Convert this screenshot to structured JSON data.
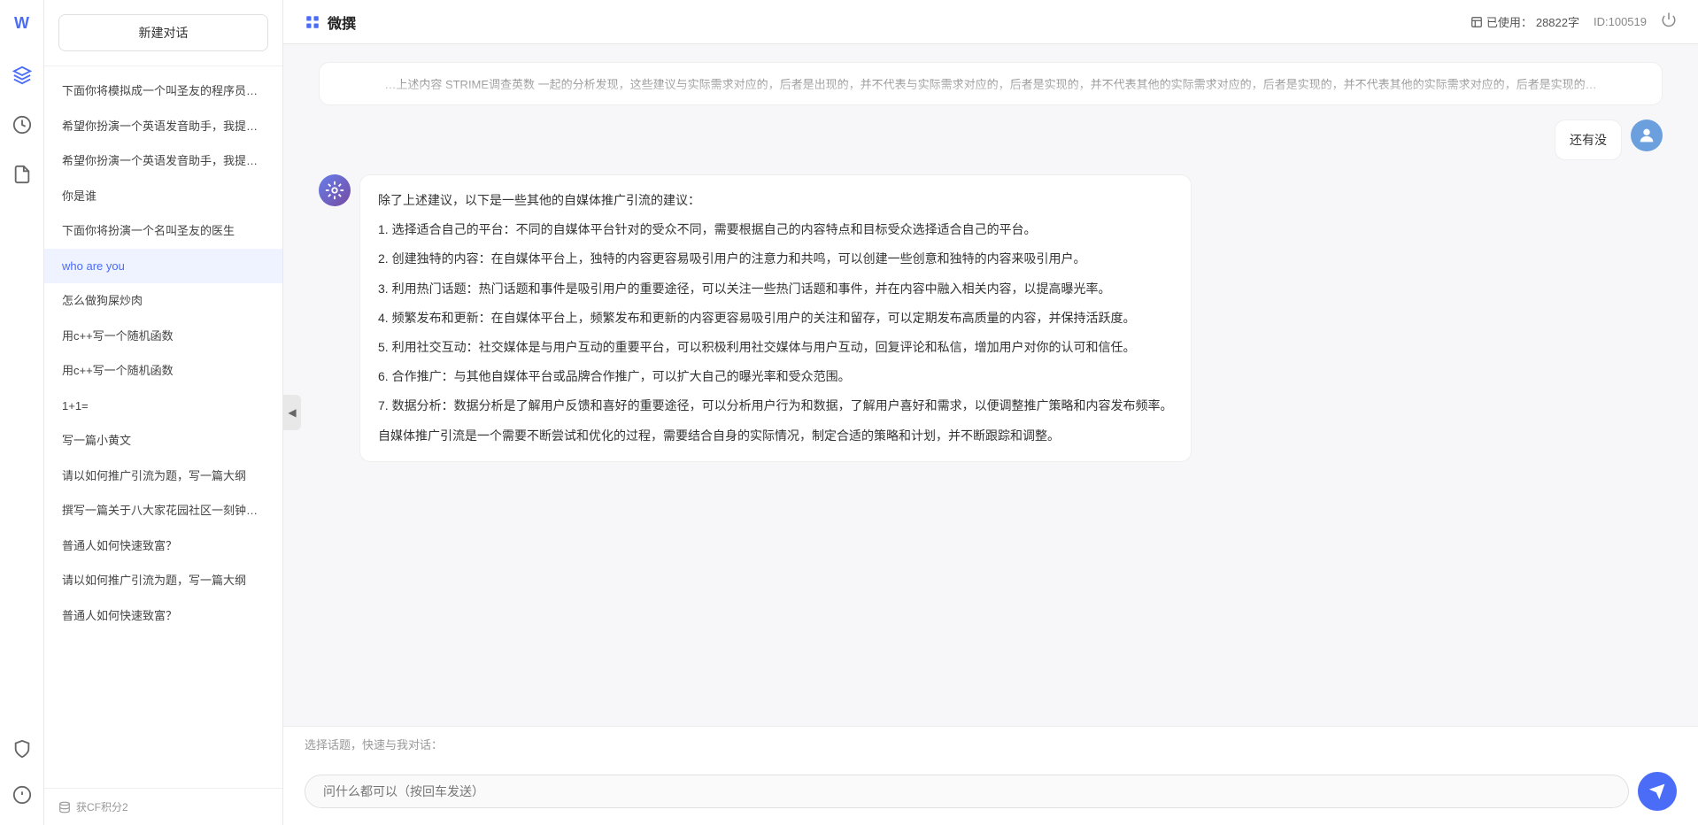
{
  "app": {
    "title": "微撰",
    "usage_label": "已使用：",
    "usage_value": "28822字",
    "id_label": "ID:100519"
  },
  "sidebar": {
    "new_chat": "新建对话",
    "items": [
      {
        "id": 1,
        "label": "下面你将模拟成一个叫圣友的程序员，我说..."
      },
      {
        "id": 2,
        "label": "希望你扮演一个英语发音助手，我提供给你..."
      },
      {
        "id": 3,
        "label": "希望你扮演一个英语发音助手，我提供给你..."
      },
      {
        "id": 4,
        "label": "你是谁"
      },
      {
        "id": 5,
        "label": "下面你将扮演一个名叫圣友的医生"
      },
      {
        "id": 6,
        "label": "who are you",
        "active": true
      },
      {
        "id": 7,
        "label": "怎么做狗屎炒肉"
      },
      {
        "id": 8,
        "label": "用c++写一个随机函数"
      },
      {
        "id": 9,
        "label": "用c++写一个随机函数"
      },
      {
        "id": 10,
        "label": "1+1="
      },
      {
        "id": 11,
        "label": "写一篇小黄文"
      },
      {
        "id": 12,
        "label": "请以如何推广引流为题，写一篇大纲"
      },
      {
        "id": 13,
        "label": "撰写一篇关于八大家花园社区一刻钟便民生..."
      },
      {
        "id": 14,
        "label": "普通人如何快速致富？"
      },
      {
        "id": 15,
        "label": "请以如何推广引流为题，写一篇大纲"
      },
      {
        "id": 16,
        "label": "普通人如何快速致富？"
      }
    ],
    "bottom_label": "获CF积分2"
  },
  "chat": {
    "prev_message_text": "…上述内容  STRIME调查英数  一起的分析发现，这些建议与实际需求对应的，后者是出现的，并不代表与实际需求对应的，后者是实现的，并不代表其他的实际需求对应的，后者是实现的，并不代表其他的实际需求对应的，后者是实现的…",
    "user_message": "还有没",
    "ai_response": {
      "intro": "除了上述建议，以下是一些其他的自媒体推广引流的建议：",
      "points": [
        "1. 选择适合自己的平台：不同的自媒体平台针对的受众不同，需要根据自己的内容特点和目标受众选择适合自己的平台。",
        "2. 创建独特的内容：在自媒体平台上，独特的内容更容易吸引用户的注意力和共鸣，可以创建一些创意和独特的内容来吸引用户。",
        "3. 利用热门话题：热门话题和事件是吸引用户的重要途径，可以关注一些热门话题和事件，并在内容中融入相关内容，以提高曝光率。",
        "4. 频繁发布和更新：在自媒体平台上，频繁发布和更新的内容更容易吸引用户的关注和留存，可以定期发布高质量的内容，并保持活跃度。",
        "5. 利用社交互动：社交媒体是与用户互动的重要平台，可以积极利用社交媒体与用户互动，回复评论和私信，增加用户对你的认可和信任。",
        "6. 合作推广：与其他自媒体平台或品牌合作推广，可以扩大自己的曝光率和受众范围。",
        "7. 数据分析：数据分析是了解用户反馈和喜好的重要途径，可以分析用户行为和数据，了解用户喜好和需求，以便调整推广策略和内容发布频率。"
      ],
      "conclusion": "自媒体推广引流是一个需要不断尝试和优化的过程，需要结合自身的实际情况，制定合适的策略和计划，并不断跟踪和调整。"
    }
  },
  "quick_bar": {
    "label": "选择话题，快速与我对话："
  },
  "input": {
    "placeholder": "问什么都可以（按回车发送）"
  },
  "icons": {
    "logo": "W",
    "cube": "⬡",
    "clock": "⏰",
    "file": "📄",
    "shield": "🛡",
    "info": "ℹ",
    "collapse": "◀",
    "send": "➤",
    "power": "⏻",
    "database": "🗄"
  }
}
